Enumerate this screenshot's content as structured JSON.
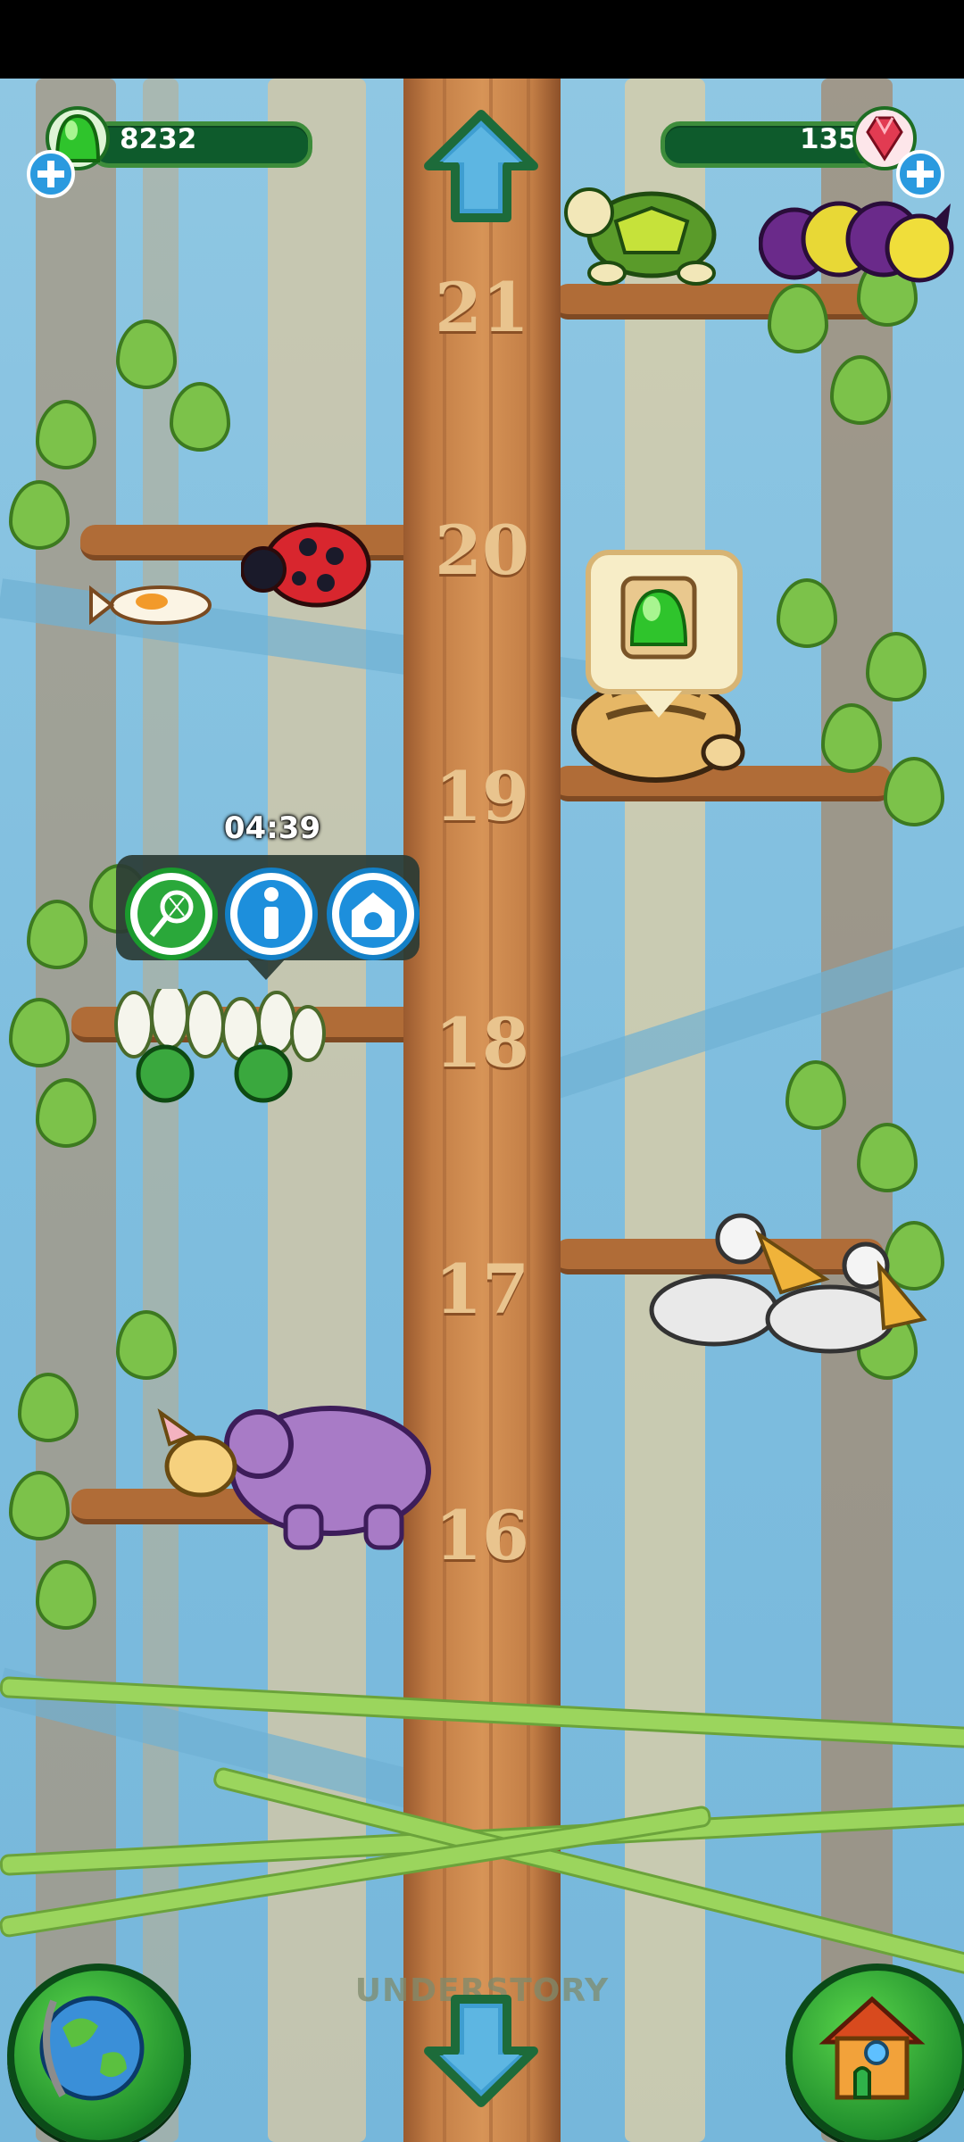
{
  "hud": {
    "jelly_count": "8232",
    "gem_count": "135",
    "jelly_icon": "green-jelly-icon",
    "gem_icon": "red-gem-icon",
    "add_icon": "plus-icon"
  },
  "tree": {
    "levels": [
      "21",
      "20",
      "19",
      "18",
      "17",
      "16"
    ]
  },
  "popup": {
    "timer": "04:39",
    "buttons": [
      "net-icon",
      "info-icon",
      "habitat-icon"
    ]
  },
  "zone": {
    "label": "UNDERSTORY"
  },
  "colors": {
    "trunk": "#c27d45",
    "leaf": "#7cc24a",
    "hud_bar": "#0e5b2c",
    "button_green": "#1f8d2c"
  }
}
